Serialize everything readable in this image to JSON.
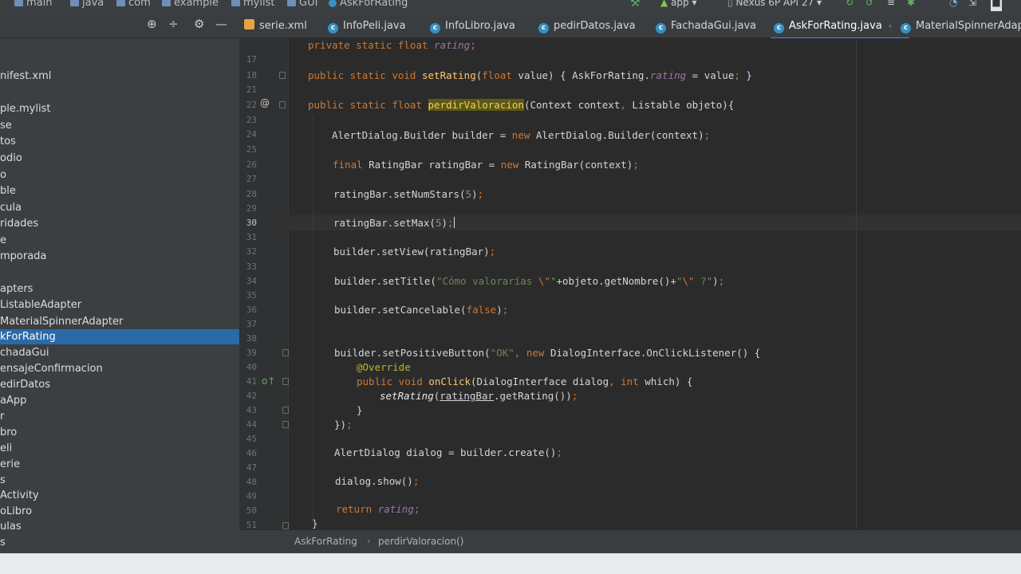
{
  "navbar": {
    "crumbs": [
      "main",
      "java",
      "com",
      "example",
      "mylist",
      "GUI",
      "AskForRating"
    ],
    "run_config": "app",
    "device": "Nexus 6P API 27"
  },
  "toolbar": {
    "icons": [
      "target-icon",
      "collapse-icon",
      "gear-icon",
      "minimize-icon"
    ]
  },
  "tabs": [
    {
      "label": "serie.xml",
      "icon": "xml-file-icon"
    },
    {
      "label": "InfoPeli.java",
      "icon": "java-class-icon"
    },
    {
      "label": "InfoLibro.java",
      "icon": "java-class-icon"
    },
    {
      "label": "pedirDatos.java",
      "icon": "java-class-icon"
    },
    {
      "label": "FachadaGui.java",
      "icon": "java-class-icon"
    },
    {
      "label": "AskForRating.java",
      "icon": "java-class-icon",
      "active": true
    },
    {
      "label": "MaterialSpinnerAdapte",
      "icon": "java-class-icon"
    }
  ],
  "sidebar": {
    "items": [
      {
        "label": "nifest.xml"
      },
      {
        "label": "ple.mylist"
      },
      {
        "label": "se"
      },
      {
        "label": "tos"
      },
      {
        "label": "odio"
      },
      {
        "label": "o"
      },
      {
        "label": "ble"
      },
      {
        "label": "cula"
      },
      {
        "label": "ridades"
      },
      {
        "label": "e"
      },
      {
        "label": "mporada"
      },
      {
        "label": "apters"
      },
      {
        "label": "ListableAdapter"
      },
      {
        "label": "MaterialSpinnerAdapter"
      },
      {
        "label": "kForRating",
        "selected": true
      },
      {
        "label": "chadaGui"
      },
      {
        "label": "ensajeConfirmacion"
      },
      {
        "label": "edirDatos"
      },
      {
        "label": "aApp"
      },
      {
        "label": "r"
      },
      {
        "label": "bro"
      },
      {
        "label": "eli"
      },
      {
        "label": "erie"
      },
      {
        "label": "s"
      },
      {
        "label": "Activity"
      },
      {
        "label": "oLibro"
      },
      {
        "label": "ulas"
      },
      {
        "label": "s"
      }
    ]
  },
  "editor": {
    "current_line": "30",
    "lines": [
      {
        "n": "",
        "t": "private static float rating;"
      },
      {
        "n": "17",
        "t": ""
      },
      {
        "n": "18",
        "t": "public static void setRating(float value) { AskForRating.rating = value; }"
      },
      {
        "n": "21",
        "t": ""
      },
      {
        "n": "22",
        "t": "public static float perdirValoracion(Context context, Listable objeto){"
      },
      {
        "n": "23",
        "t": ""
      },
      {
        "n": "24",
        "t": "AlertDialog.Builder builder = new AlertDialog.Builder(context);"
      },
      {
        "n": "25",
        "t": ""
      },
      {
        "n": "26",
        "t": "final RatingBar ratingBar = new RatingBar(context);"
      },
      {
        "n": "27",
        "t": ""
      },
      {
        "n": "28",
        "t": "ratingBar.setNumStars(5);"
      },
      {
        "n": "29",
        "t": ""
      },
      {
        "n": "30",
        "t": "ratingBar.setMax(5);"
      },
      {
        "n": "31",
        "t": ""
      },
      {
        "n": "32",
        "t": "builder.setView(ratingBar);"
      },
      {
        "n": "33",
        "t": ""
      },
      {
        "n": "34",
        "t": "builder.setTitle(\"Cómo valorarías \\\"\"+objeto.getNombre()+\"\\\" ?\");"
      },
      {
        "n": "35",
        "t": ""
      },
      {
        "n": "36",
        "t": "builder.setCancelable(false);"
      },
      {
        "n": "37",
        "t": ""
      },
      {
        "n": "38",
        "t": ""
      },
      {
        "n": "39",
        "t": "builder.setPositiveButton(\"OK\", new DialogInterface.OnClickListener() {"
      },
      {
        "n": "40",
        "t": "@Override"
      },
      {
        "n": "41",
        "t": "public void onClick(DialogInterface dialog, int which) {"
      },
      {
        "n": "42",
        "t": "setRating(ratingBar.getRating());"
      },
      {
        "n": "43",
        "t": "}"
      },
      {
        "n": "44",
        "t": "});"
      },
      {
        "n": "45",
        "t": ""
      },
      {
        "n": "46",
        "t": "AlertDialog dialog = builder.create();"
      },
      {
        "n": "47",
        "t": ""
      },
      {
        "n": "48",
        "t": "dialog.show();"
      },
      {
        "n": "49",
        "t": ""
      },
      {
        "n": "50",
        "t": "return rating;"
      },
      {
        "n": "51",
        "t": "}"
      }
    ]
  },
  "footer": {
    "breadcrumb": [
      "AskForRating",
      "perdirValoracion()"
    ]
  },
  "colors": {
    "keyword": "#cc7832",
    "method": "#ffc66d",
    "field": "#9876aa",
    "number": "#6897bb",
    "string": "#6a8759",
    "annotation": "#bbb529",
    "selection": "#2a6aa8",
    "tab_underline": "#4a88c7"
  }
}
